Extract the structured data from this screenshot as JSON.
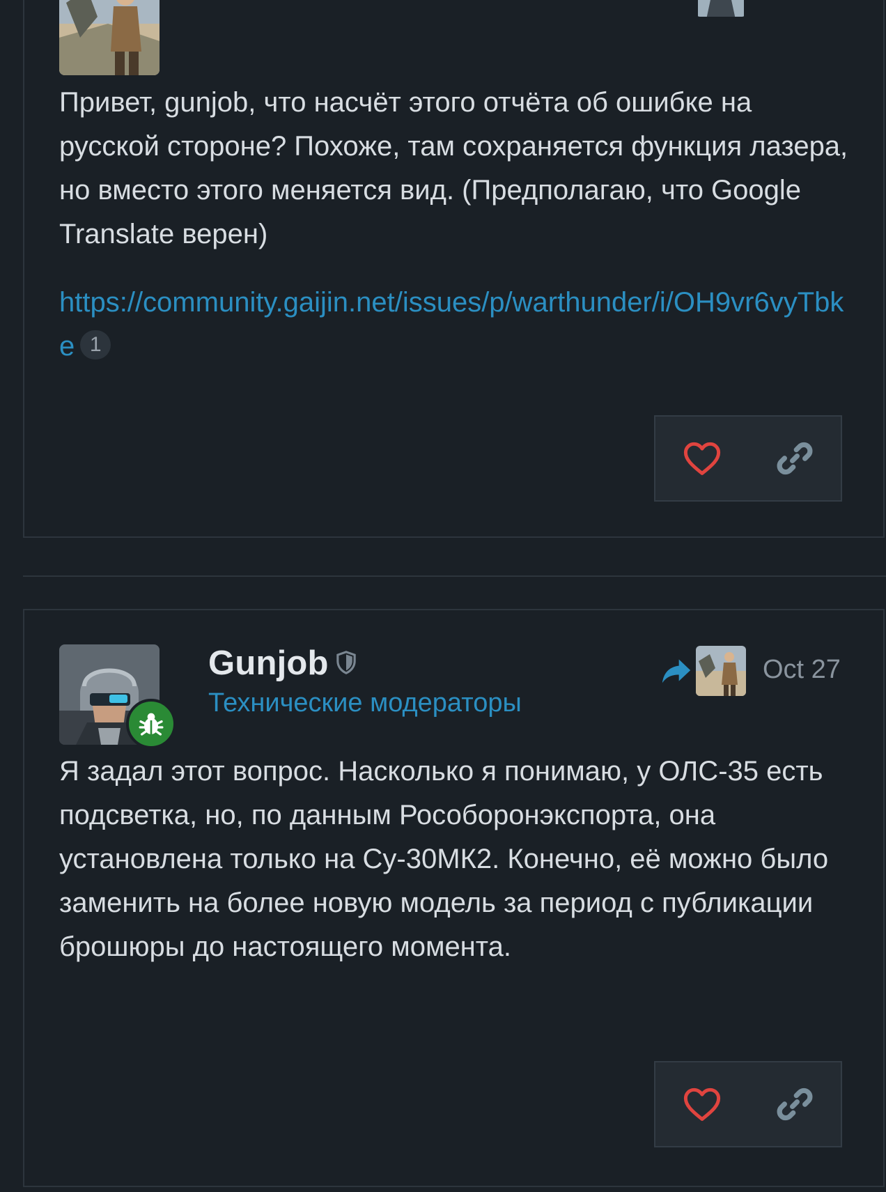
{
  "posts": [
    {
      "username": "",
      "body": [
        "Привет, gunjob, что насчёт этого отчёта об ошибке на русской стороне? Похоже, там сохраняется функция лазера, но вместо этого меняется вид. (Предполагаю, что Google Translate верен)"
      ],
      "link": {
        "text": "https://community.gaijin.net/issues/p/warthunder/i/OH9vr6vyTbke",
        "clicks": "1"
      },
      "icons": {
        "like": "heart-icon",
        "share": "link-icon"
      }
    },
    {
      "username": "Gunjob",
      "usergroup": "Технические модераторы",
      "date": "Oct 27",
      "body": [
        "Я задал этот вопрос. Насколько я понимаю, у ОЛС-35 есть подсветка, но, по данным Рособоронэкспорта, она установлена только на Су-30МК2. Конечно, её можно было заменить на более новую модель за период с публикации брошюры до настоящего момента."
      ],
      "icons": {
        "like": "heart-icon",
        "share": "link-icon",
        "reply_to": "reply-arrow-icon",
        "moderator": "shield-icon",
        "flair": "bug-icon"
      }
    }
  ],
  "colors": {
    "background": "#1a2026",
    "accent": "#2b8fc2",
    "like": "#e0443f",
    "flair": "#2a8a35",
    "muted": "#8a949e"
  }
}
